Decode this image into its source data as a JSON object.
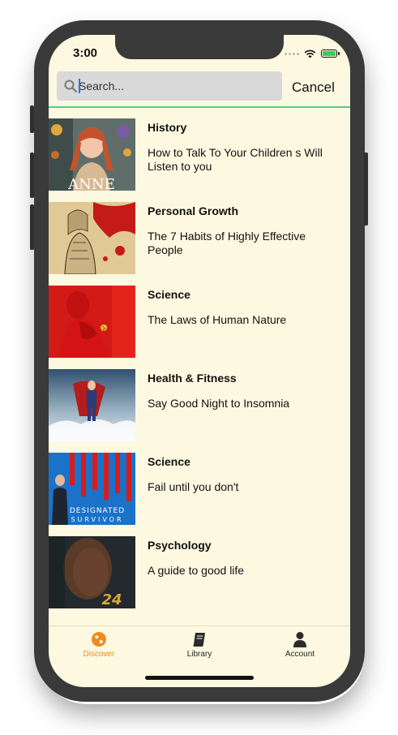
{
  "status_bar": {
    "time": "3:00"
  },
  "search": {
    "placeholder": "Search...",
    "value": "",
    "cancel_label": "Cancel"
  },
  "books": [
    {
      "category": "History",
      "title": "How to Talk To Your Children s Will Listen to you",
      "cover_text": "ANNE"
    },
    {
      "category": "Personal Growth",
      "title": "The 7 Habits of Highly Effective People"
    },
    {
      "category": "Science",
      "title": "The Laws of Human Nature"
    },
    {
      "category": "Health & Fitness",
      "title": "Say Good Night to Insomnia"
    },
    {
      "category": "Science",
      "title": "Fail until you don't",
      "cover_text_1": "DESIGNATED",
      "cover_text_2": "SURVIVOR"
    },
    {
      "category": "Psychology",
      "title": "A guide to good life",
      "cover_text": "24"
    }
  ],
  "tabs": [
    {
      "label": "Discover",
      "icon": "globe-icon",
      "active": true
    },
    {
      "label": "Library",
      "icon": "book-icon",
      "active": false
    },
    {
      "label": "Account",
      "icon": "person-icon",
      "active": false
    }
  ],
  "colors": {
    "background": "#fdf9e1",
    "accent": "#f18a1f",
    "divider": "#62c58c",
    "battery": "#30d158"
  }
}
